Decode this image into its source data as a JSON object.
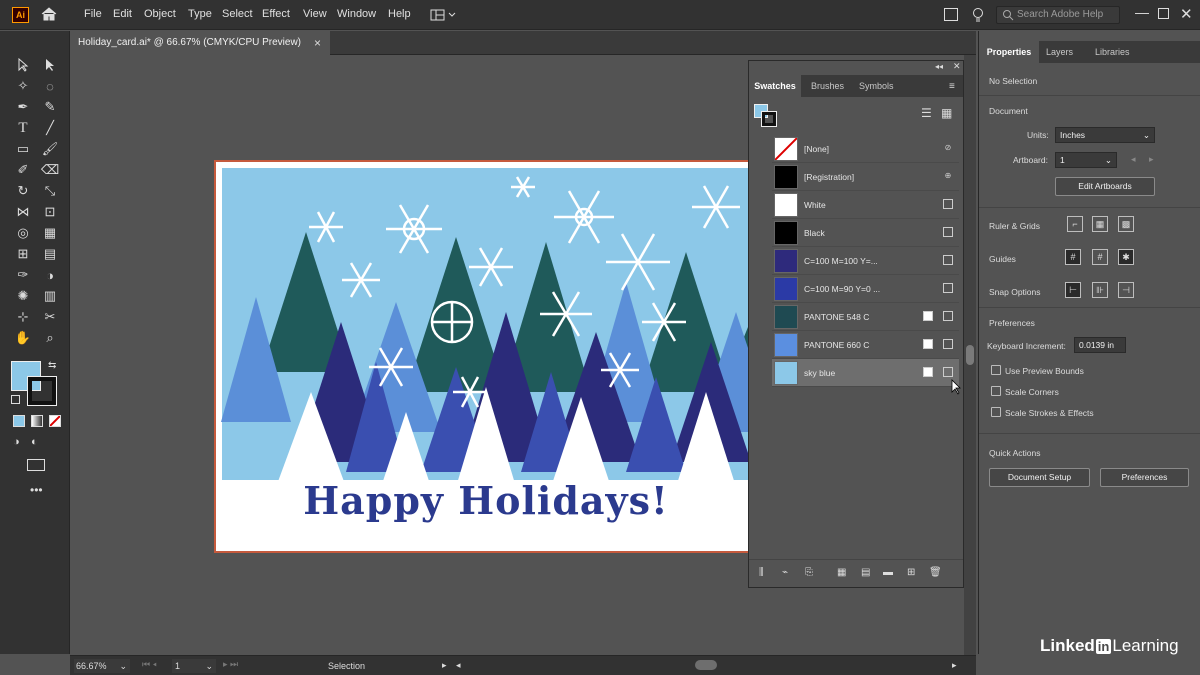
{
  "app": {
    "logo": "Ai",
    "menus": [
      "File",
      "Edit",
      "Object",
      "Type",
      "Select",
      "Effect",
      "View",
      "Window",
      "Help"
    ],
    "search_placeholder": "Search Adobe Help"
  },
  "document": {
    "tab_title": "Holiday_card.ai* @ 66.67% (CMYK/CPU Preview)",
    "close": "×"
  },
  "artwork": {
    "greeting": "Happy Holidays!",
    "colors": {
      "sky": "#8cc8e8",
      "tree_dark": "#1f5a5a",
      "tree_navy": "#2b2b7a",
      "tree_blue": "#3a4fb0",
      "tree_light": "#5b8fd8",
      "snow": "#ffffff"
    }
  },
  "swatches": {
    "tabs": [
      "Swatches",
      "Brushes",
      "Symbols"
    ],
    "items": [
      {
        "name": "[None]",
        "color": "#ffffff"
      },
      {
        "name": "[Registration]",
        "color": "#000000"
      },
      {
        "name": "White",
        "color": "#ffffff"
      },
      {
        "name": "Black",
        "color": "#000000"
      },
      {
        "name": "C=100 M=100 Y=...",
        "color": "#2e2a7c"
      },
      {
        "name": "C=100 M=90 Y=0 ...",
        "color": "#2b3aa6"
      },
      {
        "name": "PANTONE 548 C",
        "color": "#1f4a52"
      },
      {
        "name": "PANTONE 660 C",
        "color": "#5b8fe0"
      },
      {
        "name": "sky blue",
        "color": "#8cc8e8"
      }
    ],
    "selected": "sky blue"
  },
  "properties": {
    "tabs": [
      "Properties",
      "Layers",
      "Libraries"
    ],
    "no_selection": "No Selection",
    "document_label": "Document",
    "units_label": "Units:",
    "units_value": "Inches",
    "artboard_label": "Artboard:",
    "artboard_value": "1",
    "edit_artboards": "Edit Artboards",
    "ruler_grids": "Ruler & Grids",
    "guides": "Guides",
    "snap_options": "Snap Options",
    "preferences_label": "Preferences",
    "keyboard_increment_label": "Keyboard Increment:",
    "keyboard_increment_value": "0.0139 in",
    "use_preview_bounds": "Use Preview Bounds",
    "scale_corners": "Scale Corners",
    "scale_strokes": "Scale Strokes & Effects",
    "quick_actions": "Quick Actions",
    "document_setup": "Document Setup",
    "preferences_button": "Preferences"
  },
  "status": {
    "zoom": "66.67%",
    "artboard": "1",
    "tool": "Selection"
  },
  "branding": {
    "linked": "Linked",
    "in": "in",
    "learning": "Learning"
  }
}
